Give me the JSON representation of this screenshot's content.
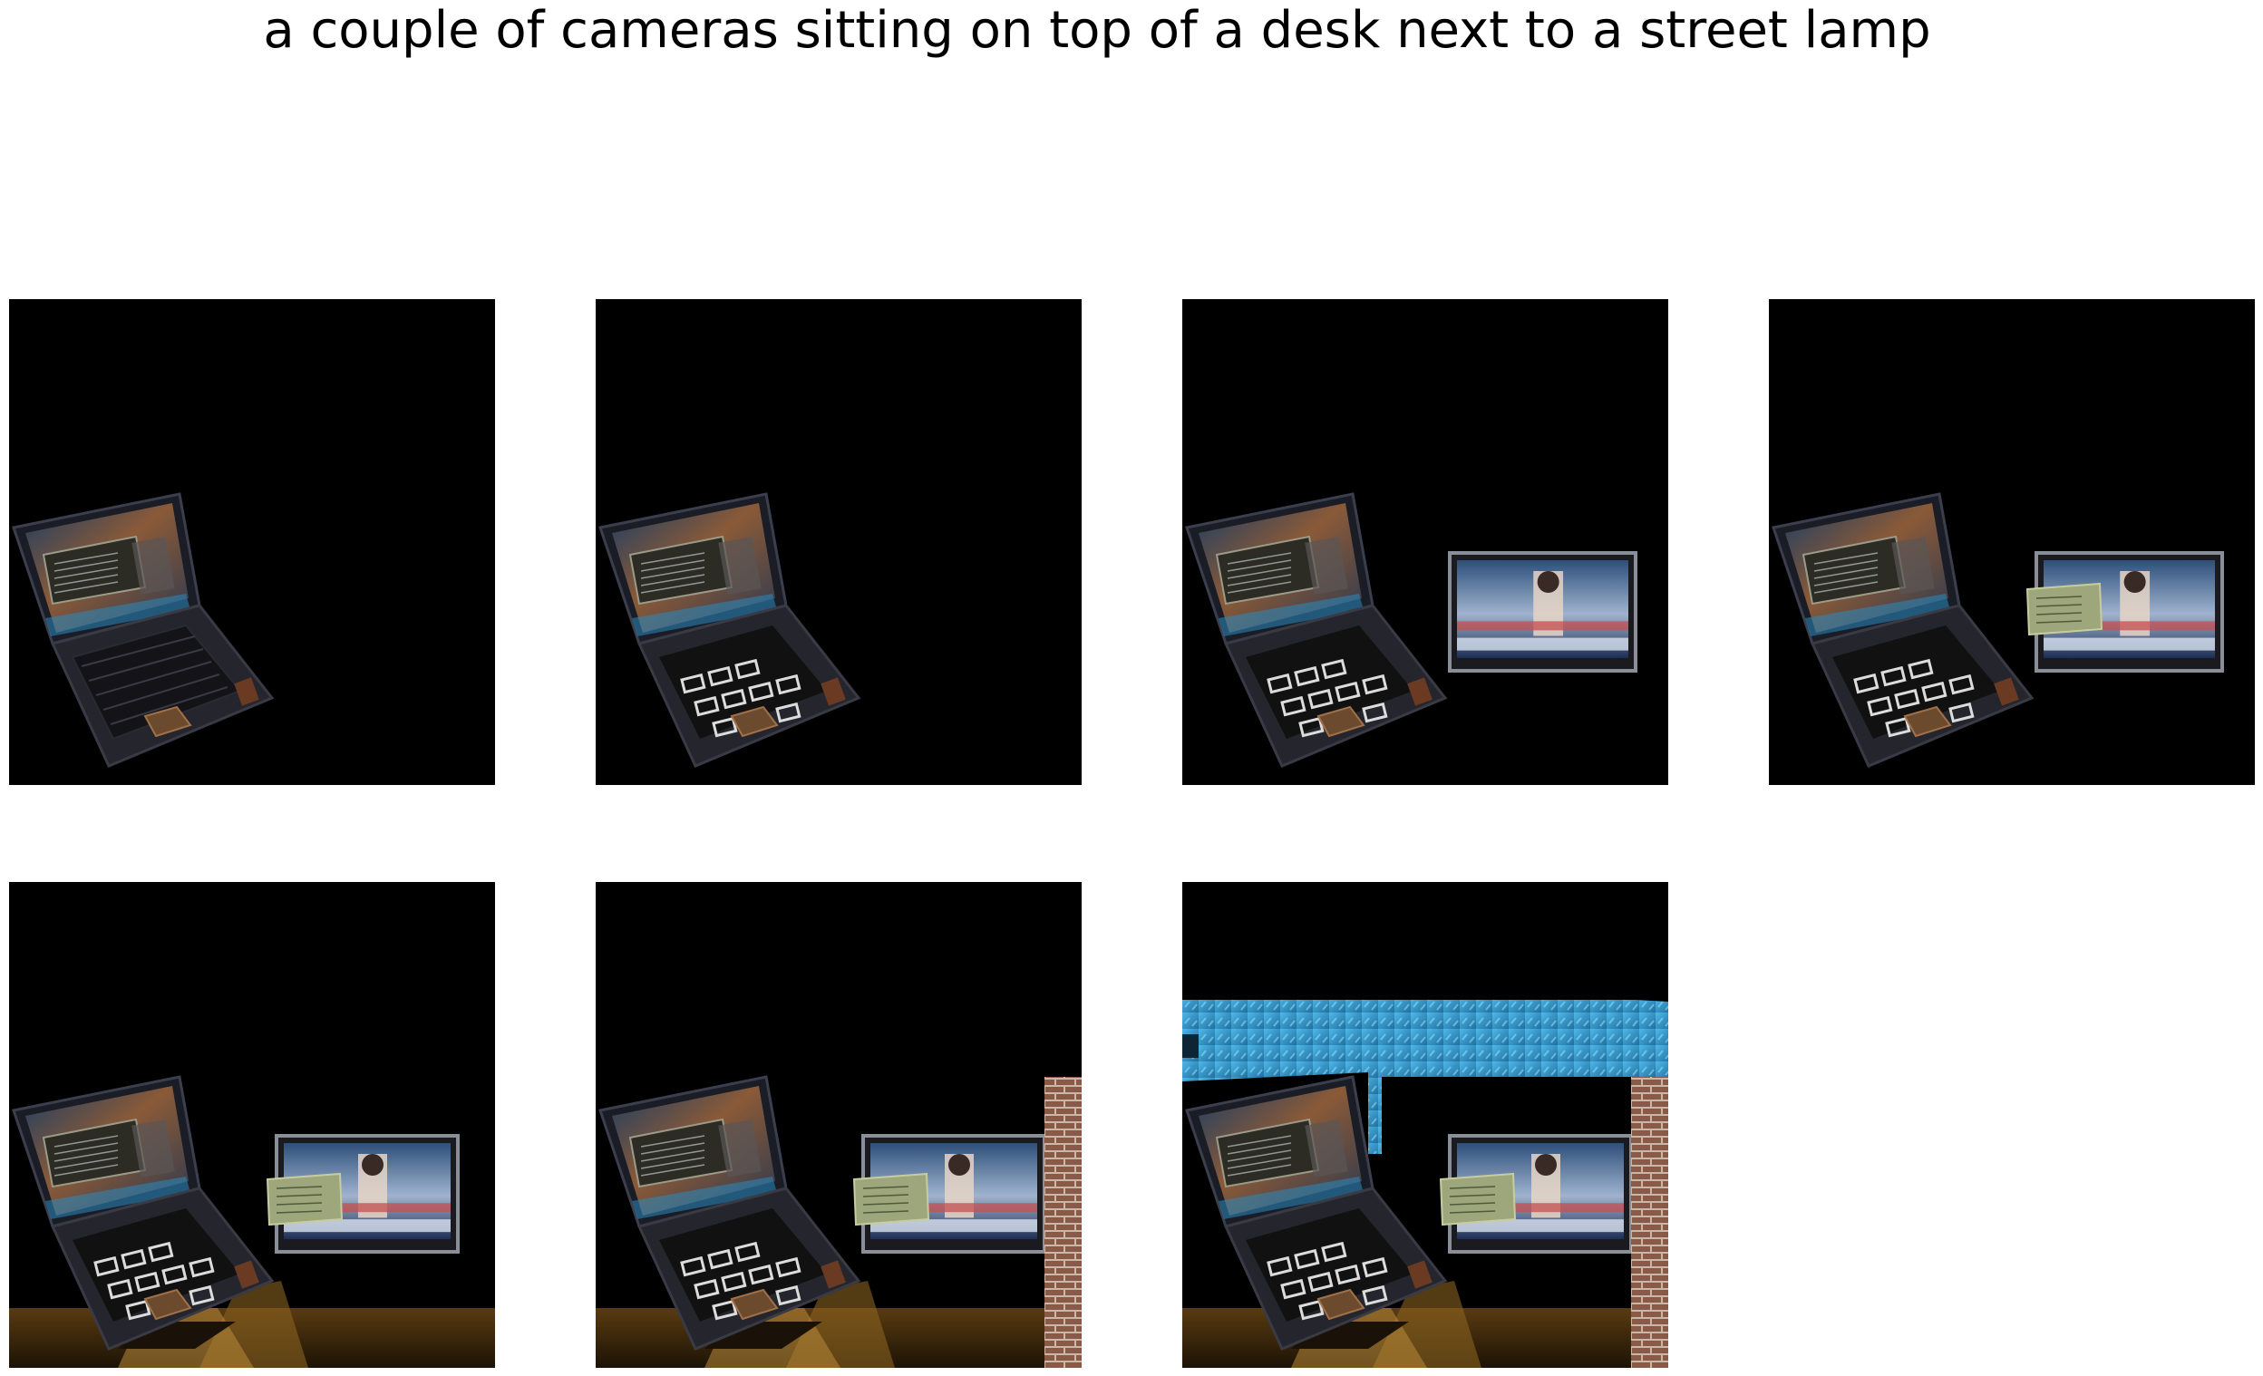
{
  "title": "a couple of cameras sitting on top of a desk next to a street lamp",
  "panels": [
    {
      "objects": [
        "laptop"
      ]
    },
    {
      "objects": [
        "laptop"
      ]
    },
    {
      "objects": [
        "laptop",
        "tv"
      ]
    },
    {
      "objects": [
        "laptop",
        "tv",
        "note"
      ]
    },
    {
      "objects": [
        "laptop",
        "tv",
        "note",
        "lamp"
      ]
    },
    {
      "objects": [
        "laptop",
        "tv",
        "note",
        "lamp",
        "brick"
      ]
    },
    {
      "objects": [
        "laptop",
        "tv",
        "note",
        "lamp",
        "brick",
        "metal"
      ]
    }
  ]
}
